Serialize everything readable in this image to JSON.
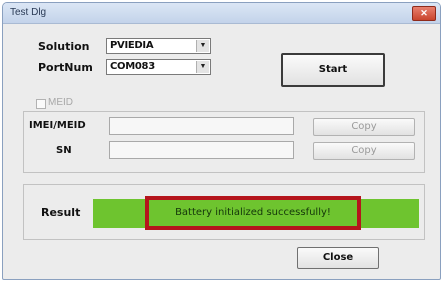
{
  "window": {
    "title": "Test Dlg"
  },
  "form": {
    "solution_label": "Solution",
    "solution_value": "PVIEDIA",
    "portnum_label": "PortNum",
    "portnum_value": "COM083",
    "start_label": "Start",
    "meid_checkbox_label": "MEID",
    "meid_label": "IMEI/MEID",
    "sn_label": "SN",
    "copy_label_1": "Copy",
    "copy_label_2": "Copy"
  },
  "result": {
    "label": "Result",
    "message": "Battery initialized successfully!",
    "colors": {
      "bar": "#6ec42f",
      "highlight_border": "#b5151c"
    }
  },
  "footer": {
    "close_label": "Close"
  }
}
